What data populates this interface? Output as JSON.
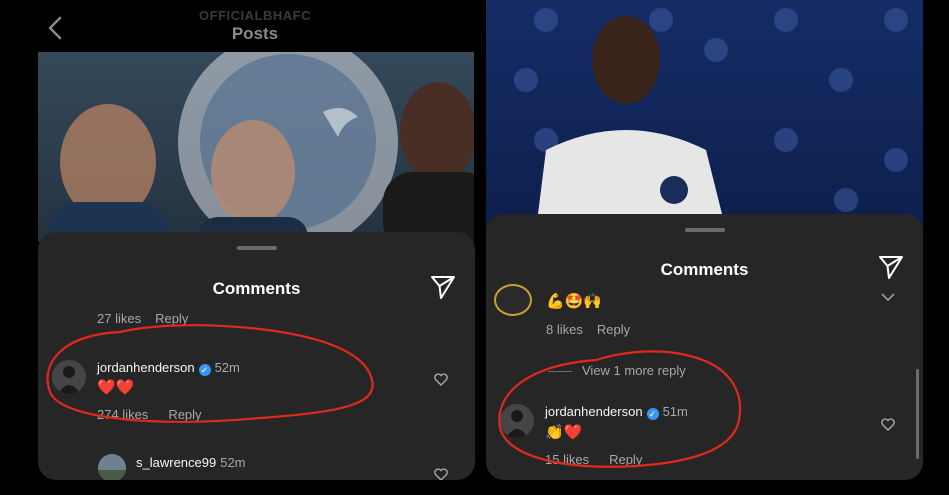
{
  "left": {
    "header": {
      "account": "OFFICIALBHAFC",
      "title": "Posts"
    },
    "sheet": {
      "title": "Comments",
      "prev_comment": {
        "likes": "27 likes",
        "reply": "Reply"
      },
      "highlight_comment": {
        "username": "jordanhenderson",
        "time": "52m",
        "text": "❤️❤️",
        "likes": "274 likes",
        "reply": "Reply"
      },
      "next_comment": {
        "username": "s_lawrence99",
        "time": "52m"
      }
    }
  },
  "right": {
    "sheet": {
      "title": "Comments",
      "prev_comment": {
        "text": "💪🤩🙌",
        "likes": "8 likes",
        "reply": "Reply"
      },
      "view_more": "View 1 more reply",
      "highlight_comment": {
        "username": "jordanhenderson",
        "time": "51m",
        "text": "👏❤️",
        "likes": "15 likes",
        "reply": "Reply"
      }
    }
  },
  "colors": {
    "sheet_bg": "#262626",
    "annotation": "#e0281e",
    "verified": "#3897f0"
  }
}
